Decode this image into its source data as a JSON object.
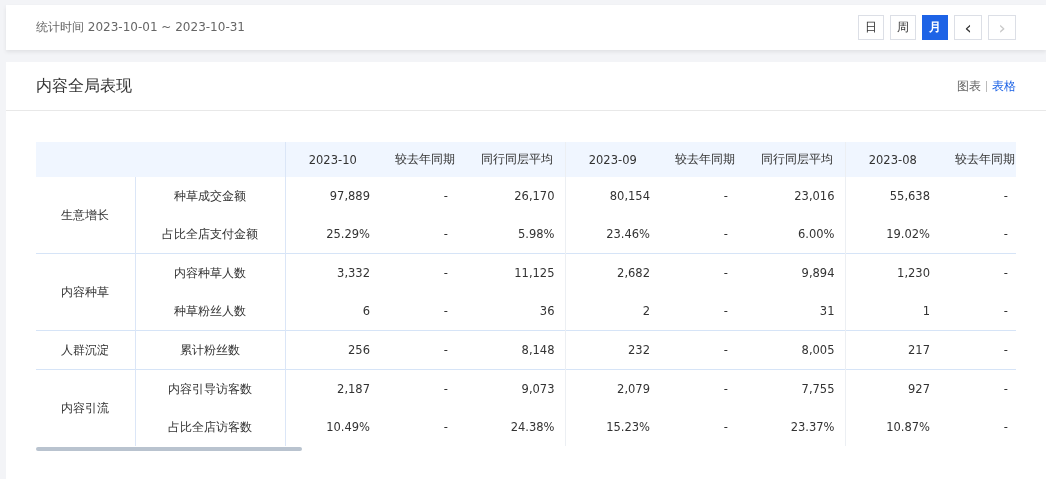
{
  "filter_bar": {
    "date_range": "统计时间 2023-10-01 ~ 2023-10-31",
    "period_buttons": [
      {
        "label": "日",
        "selected": false
      },
      {
        "label": "周",
        "selected": false
      },
      {
        "label": "月",
        "selected": true
      }
    ],
    "prev_button": {
      "label": "‹",
      "disabled": false
    },
    "next_button": {
      "label": "›",
      "disabled": true
    }
  },
  "panel": {
    "title": "内容全局表现",
    "view_tabs": [
      {
        "label": "图表",
        "selected": false
      },
      {
        "label": "表格",
        "selected": true
      }
    ]
  },
  "table": {
    "columns": [
      "2023-10",
      "较去年同期",
      "同行同层平均",
      "2023-09",
      "较去年同期",
      "同行同层平均",
      "2023-08",
      "较去年同期"
    ],
    "groups": [
      {
        "name": "生意增长",
        "rows": [
          {
            "metric": "种草成交金额",
            "values": [
              "97,889",
              "-",
              "26,170",
              "80,154",
              "-",
              "23,016",
              "55,638",
              "-"
            ]
          },
          {
            "metric": "占比全店支付金额",
            "values": [
              "25.29%",
              "-",
              "5.98%",
              "23.46%",
              "-",
              "6.00%",
              "19.02%",
              "-"
            ]
          }
        ]
      },
      {
        "name": "内容种草",
        "rows": [
          {
            "metric": "内容种草人数",
            "values": [
              "3,332",
              "-",
              "11,125",
              "2,682",
              "-",
              "9,894",
              "1,230",
              "-"
            ]
          },
          {
            "metric": "种草粉丝人数",
            "values": [
              "6",
              "-",
              "36",
              "2",
              "-",
              "31",
              "1",
              "-"
            ]
          }
        ]
      },
      {
        "name": "人群沉淀",
        "rows": [
          {
            "metric": "累计粉丝数",
            "values": [
              "256",
              "-",
              "8,148",
              "232",
              "-",
              "8,005",
              "217",
              "-"
            ]
          }
        ]
      },
      {
        "name": "内容引流",
        "rows": [
          {
            "metric": "内容引导访客数",
            "values": [
              "2,187",
              "-",
              "9,073",
              "2,079",
              "-",
              "7,755",
              "927",
              "-"
            ]
          },
          {
            "metric": "占比全店访客数",
            "values": [
              "10.49%",
              "-",
              "24.38%",
              "15.23%",
              "-",
              "23.37%",
              "10.87%",
              "-"
            ]
          }
        ]
      }
    ]
  }
}
